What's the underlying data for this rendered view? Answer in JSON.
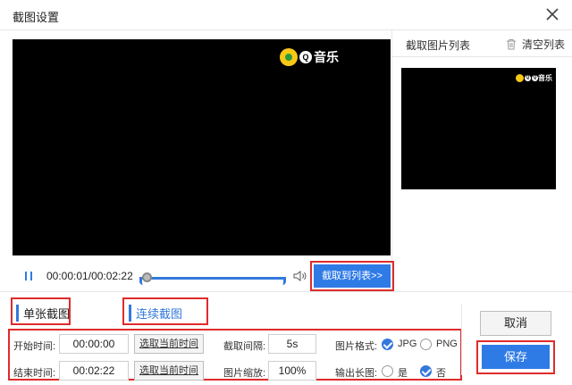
{
  "window": {
    "title": "截图设置"
  },
  "video": {
    "watermark": "音乐",
    "watermark_badge": "Q"
  },
  "player": {
    "time_current": "00:00:01",
    "time_total": "00:02:22",
    "time_separator": "/",
    "progress": 0.02
  },
  "capture_button_label": "截取到列表>>",
  "list_panel": {
    "title": "截取图片列表",
    "clear_label": "清空列表"
  },
  "tabs": [
    {
      "label": "单张截图",
      "active": true
    },
    {
      "label": "连续截图",
      "active": false
    }
  ],
  "form": {
    "start_label": "开始时间:",
    "start_value": "00:00:00",
    "end_label": "结束时间:",
    "end_value": "00:02:22",
    "select_current_label": "选取当前时间",
    "interval_label": "截取间隔:",
    "interval_value": "5s",
    "scale_label": "图片缩放:",
    "scale_value": "100%",
    "format_label": "图片格式:",
    "format_options": [
      "JPG",
      "PNG"
    ],
    "format_selected": "JPG",
    "long_label": "输出长图:",
    "long_options": [
      "是",
      "否"
    ],
    "long_selected": "否"
  },
  "actions": {
    "cancel_label": "取消",
    "save_label": "保存"
  },
  "colors": {
    "accent": "#2f7be6",
    "highlight": "#e02b2b",
    "logo": "#f7c815"
  }
}
